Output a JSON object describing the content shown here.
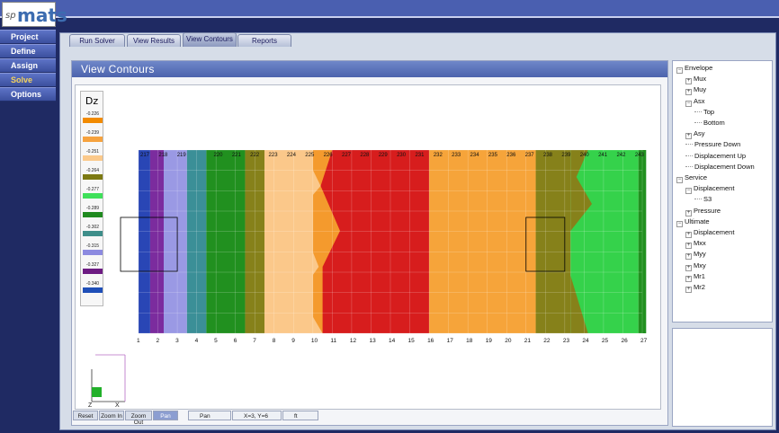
{
  "logo": {
    "prefix": "sp",
    "name": "mats"
  },
  "sidebar": {
    "items": [
      {
        "label": "Project",
        "active": false
      },
      {
        "label": "Define",
        "active": false
      },
      {
        "label": "Assign",
        "active": false
      },
      {
        "label": "Solve",
        "active": true
      },
      {
        "label": "Options",
        "active": false
      }
    ]
  },
  "tabs": [
    {
      "label": "Run Solver"
    },
    {
      "label": "View Results"
    },
    {
      "label": "View Contours"
    },
    {
      "label": "Reports"
    }
  ],
  "panel": {
    "title": "View Contours"
  },
  "legend": {
    "title": "Dz",
    "entries": [
      {
        "value": "-0.226",
        "color": "#f28b00"
      },
      {
        "value": "-0.239",
        "color": "#f6a23e"
      },
      {
        "value": "-0.251",
        "color": "#fbc98b"
      },
      {
        "value": "-0.264",
        "color": "#7d7a12"
      },
      {
        "value": "-0.277",
        "color": "#3fe05a"
      },
      {
        "value": "-0.289",
        "color": "#1f8a1f"
      },
      {
        "value": "-0.302",
        "color": "#3e8e8a"
      },
      {
        "value": "-0.315",
        "color": "#8c8ae0"
      },
      {
        "value": "-0.327",
        "color": "#6d1b82"
      },
      {
        "value": "-0.340",
        "color": "#1f4fb8"
      }
    ]
  },
  "contour": {
    "columns": [
      "1",
      "2",
      "3",
      "4",
      "5",
      "6",
      "7",
      "8",
      "9",
      "10",
      "11",
      "12",
      "13",
      "14",
      "15",
      "16",
      "17",
      "18",
      "19",
      "20",
      "21",
      "22",
      "23",
      "24",
      "25",
      "26",
      "27"
    ],
    "row_top_labels": [
      "217",
      "218",
      "219",
      "",
      "220",
      "221",
      "222",
      "223",
      "224",
      "225",
      "226",
      "227",
      "228",
      "229",
      "230",
      "231",
      "232",
      "233",
      "234",
      "235",
      "236",
      "237",
      "238",
      "239",
      "240",
      "241",
      "242",
      "243"
    ],
    "zones": [
      {
        "name": "blue",
        "color": "#2946b5"
      },
      {
        "name": "purple",
        "color": "#7b2c9e"
      },
      {
        "name": "lavender",
        "color": "#9a99e4"
      },
      {
        "name": "teal",
        "color": "#3b8f97"
      },
      {
        "name": "darkgreen",
        "color": "#21901f"
      },
      {
        "name": "green",
        "color": "#35d24b"
      },
      {
        "name": "olive",
        "color": "#86811a"
      },
      {
        "name": "peach",
        "color": "#fbc88a"
      },
      {
        "name": "orange",
        "color": "#f49a2d"
      },
      {
        "name": "red",
        "color": "#d71d1d"
      }
    ]
  },
  "statusbar": {
    "buttons": [
      {
        "label": "Reset"
      },
      {
        "label": "Zoom In"
      },
      {
        "label": "Zoom Out"
      },
      {
        "label": "Pan"
      }
    ],
    "mode": "Pan",
    "coords": "X=3, Y=6",
    "unit": "ft"
  },
  "axes": {
    "z": "Z",
    "x": "X"
  },
  "tree": {
    "nodes": [
      {
        "label": "Envelope",
        "level": 0,
        "box": "−"
      },
      {
        "label": "Mux",
        "level": 1,
        "box": "+"
      },
      {
        "label": "Muy",
        "level": 1,
        "box": "+"
      },
      {
        "label": "Asx",
        "level": 1,
        "box": "−"
      },
      {
        "label": "Top",
        "level": 2,
        "box": ""
      },
      {
        "label": "Bottom",
        "level": 2,
        "box": ""
      },
      {
        "label": "Asy",
        "level": 1,
        "box": "+"
      },
      {
        "label": "Pressure Down",
        "level": 1,
        "box": ""
      },
      {
        "label": "Displacement Up",
        "level": 1,
        "box": ""
      },
      {
        "label": "Displacement Down",
        "level": 1,
        "box": ""
      },
      {
        "label": "Service",
        "level": 0,
        "box": "−"
      },
      {
        "label": "Displacement",
        "level": 1,
        "box": "−"
      },
      {
        "label": "S3",
        "level": 2,
        "box": ""
      },
      {
        "label": "Pressure",
        "level": 1,
        "box": "+"
      },
      {
        "label": "Ultimate",
        "level": 0,
        "box": "−"
      },
      {
        "label": "Displacement",
        "level": 1,
        "box": "+"
      },
      {
        "label": "Mxx",
        "level": 1,
        "box": "+"
      },
      {
        "label": "Myy",
        "level": 1,
        "box": "+"
      },
      {
        "label": "Mxy",
        "level": 1,
        "box": "+"
      },
      {
        "label": "Mr1",
        "level": 1,
        "box": "+"
      },
      {
        "label": "Mr2",
        "level": 1,
        "box": "+"
      }
    ]
  }
}
